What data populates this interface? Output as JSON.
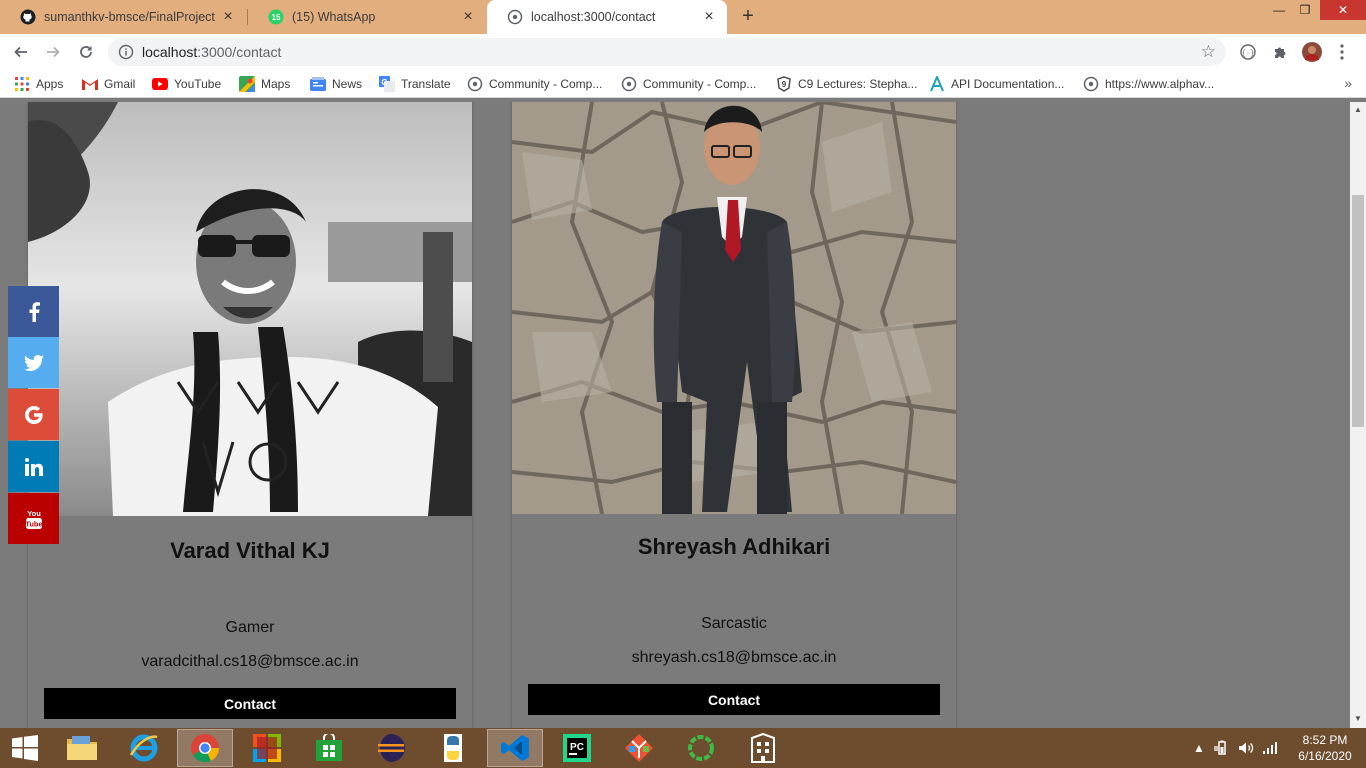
{
  "browser": {
    "tabs": [
      {
        "title": "sumanthkv-bmsce/FinalProject",
        "icon": "github-icon"
      },
      {
        "title": "(15) WhatsApp",
        "icon": "whatsapp-icon",
        "badge": "15"
      },
      {
        "title": "localhost:3000/contact",
        "icon": "globe-icon"
      }
    ],
    "url_host": "localhost",
    "url_rest": ":3000/contact",
    "bookmarks": [
      {
        "label": "Apps",
        "icon": "apps-grid-icon"
      },
      {
        "label": "Gmail",
        "icon": "gmail-icon"
      },
      {
        "label": "YouTube",
        "icon": "youtube-icon"
      },
      {
        "label": "Maps",
        "icon": "maps-icon"
      },
      {
        "label": "News",
        "icon": "news-icon"
      },
      {
        "label": "Translate",
        "icon": "translate-icon"
      },
      {
        "label": "Community - Comp...",
        "icon": "globe-icon"
      },
      {
        "label": "Community - Comp...",
        "icon": "globe-icon"
      },
      {
        "label": "C9 Lectures: Stepha...",
        "icon": "channel9-icon"
      },
      {
        "label": "API Documentation...",
        "icon": "api-icon"
      },
      {
        "label": "https://www.alphav...",
        "icon": "globe-icon"
      }
    ]
  },
  "cards": [
    {
      "name": "Varad Vithal KJ",
      "role": "Gamer",
      "email": "varadcithal.cs18@bmsce.ac.in",
      "button": "Contact"
    },
    {
      "name": "Shreyash Adhikari",
      "role": "Sarcastic",
      "email": "shreyash.cs18@bmsce.ac.in",
      "button": "Contact"
    }
  ],
  "social": [
    {
      "network": "facebook",
      "icon": "facebook-icon",
      "color": "#3b5998"
    },
    {
      "network": "twitter",
      "icon": "twitter-icon",
      "color": "#55acee"
    },
    {
      "network": "google",
      "icon": "google-icon",
      "color": "#dd4b39"
    },
    {
      "network": "linkedin",
      "icon": "linkedin-icon",
      "color": "#007bb5"
    },
    {
      "network": "youtube",
      "icon": "youtube-icon",
      "color": "#bb0000"
    }
  ],
  "taskbar": {
    "time": "8:52 PM",
    "date": "6/16/2020"
  }
}
